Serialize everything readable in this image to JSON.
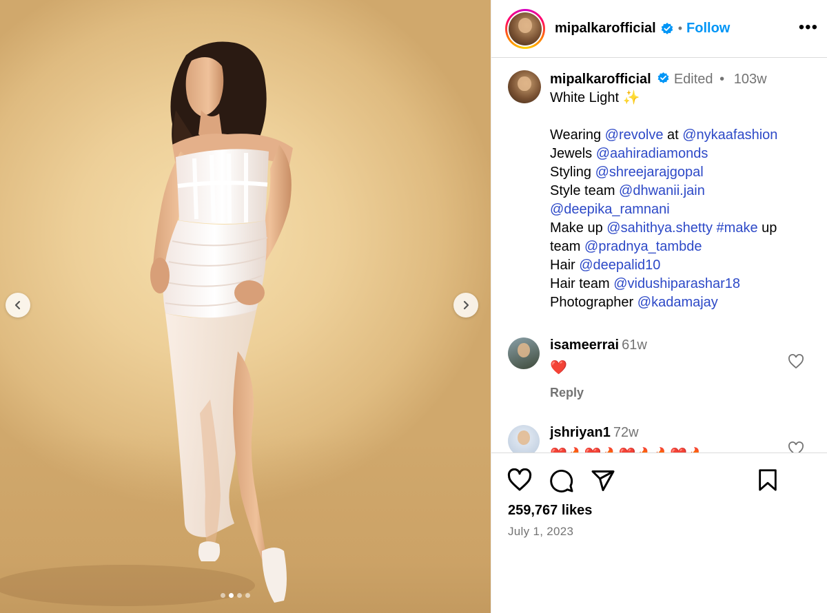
{
  "post": {
    "username": "mipalkarofficial",
    "follow_label": "Follow",
    "header_separator": "•",
    "more_label": "•••",
    "caption": {
      "username": "mipalkarofficial",
      "edited_label": "Edited",
      "separator": "•",
      "age": "103w",
      "title_text": "White Light ✨",
      "lines": [
        {
          "parts": [
            {
              "t": "Wearing "
            },
            {
              "t": "@revolve",
              "m": true
            },
            {
              "t": " at "
            },
            {
              "t": "@nykaafashion",
              "m": true
            }
          ]
        },
        {
          "parts": [
            {
              "t": "Jewels "
            },
            {
              "t": "@aahiradiamonds",
              "m": true
            }
          ]
        },
        {
          "parts": [
            {
              "t": "Styling "
            },
            {
              "t": "@shreejarajgopal",
              "m": true
            }
          ]
        },
        {
          "parts": [
            {
              "t": "Style team "
            },
            {
              "t": "@dhwanii.jain",
              "m": true
            }
          ]
        },
        {
          "parts": [
            {
              "t": "@deepika_ramnani",
              "m": true
            }
          ]
        },
        {
          "parts": [
            {
              "t": "Make up "
            },
            {
              "t": "@sahithya.shetty",
              "m": true
            },
            {
              "t": " "
            },
            {
              "t": "#make",
              "m": true
            },
            {
              "t": " up"
            }
          ]
        },
        {
          "parts": [
            {
              "t": "team "
            },
            {
              "t": "@pradnya_tambde",
              "m": true
            }
          ]
        },
        {
          "parts": [
            {
              "t": "Hair "
            },
            {
              "t": "@deepalid10",
              "m": true
            }
          ]
        },
        {
          "parts": [
            {
              "t": "Hair team "
            },
            {
              "t": "@vidushiparashar18",
              "m": true
            }
          ]
        },
        {
          "parts": [
            {
              "t": "Photographer "
            },
            {
              "t": "@kadamajay",
              "m": true
            }
          ]
        }
      ]
    },
    "comments": [
      {
        "username": "isameerrai",
        "age": "61w",
        "text": "❤️",
        "reply_label": "Reply"
      },
      {
        "username": "jshriyan1",
        "age": "72w",
        "text": "❤️🔥❤️🔥❤️🔥🔥❤️🔥"
      }
    ],
    "likes_text": "259,767 likes",
    "date_text": "July 1, 2023",
    "carousel": {
      "count": 4,
      "active_index": 1
    }
  },
  "colors": {
    "link": "#2d49c7",
    "follow": "#0095f6",
    "verified": "#0095f6",
    "heart": "#e0245e",
    "muted": "#737373"
  }
}
